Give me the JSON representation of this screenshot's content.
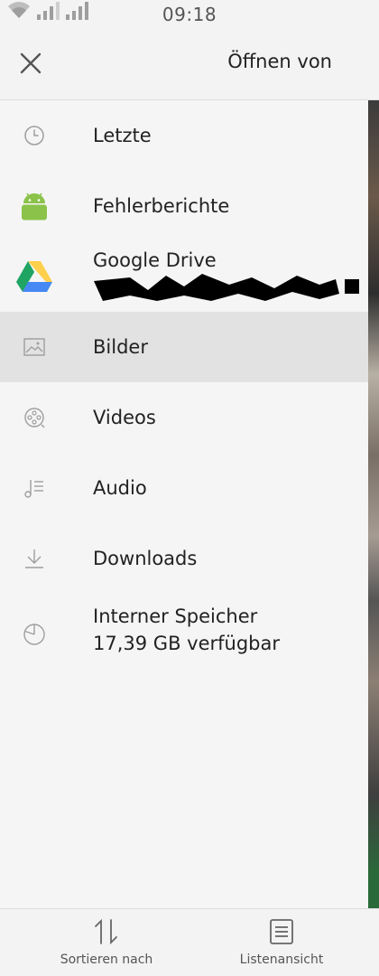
{
  "status_bar": {
    "time": "09:18",
    "icons": [
      "wifi-icon",
      "signal-icon",
      "signal-icon"
    ]
  },
  "header": {
    "title": "Öffnen von",
    "close_icon": "close-icon"
  },
  "drawer": {
    "items": [
      {
        "label": "Letzte",
        "icon": "clock-icon"
      },
      {
        "label": "Fehlerberichte",
        "icon": "android-icon"
      },
      {
        "label": "Google Drive",
        "sublabel": "",
        "icon": "google-drive-icon"
      },
      {
        "label": "Bilder",
        "icon": "image-icon",
        "selected": true
      },
      {
        "label": "Videos",
        "icon": "film-reel-icon"
      },
      {
        "label": "Audio",
        "icon": "music-note-icon"
      },
      {
        "label": "Downloads",
        "icon": "download-icon"
      },
      {
        "label": "Interner Speicher",
        "sublabel": "17,39 GB verfügbar",
        "icon": "storage-pie-icon"
      }
    ]
  },
  "bottom_bar": {
    "sort_label": "Sortieren nach",
    "list_label": "Listenansicht"
  },
  "colors": {
    "selected_bg": "#e2e2e2",
    "android_green": "#8bc34a",
    "drive_green": "#1fa463",
    "drive_yellow": "#ffd04b",
    "drive_blue": "#4688f4"
  }
}
